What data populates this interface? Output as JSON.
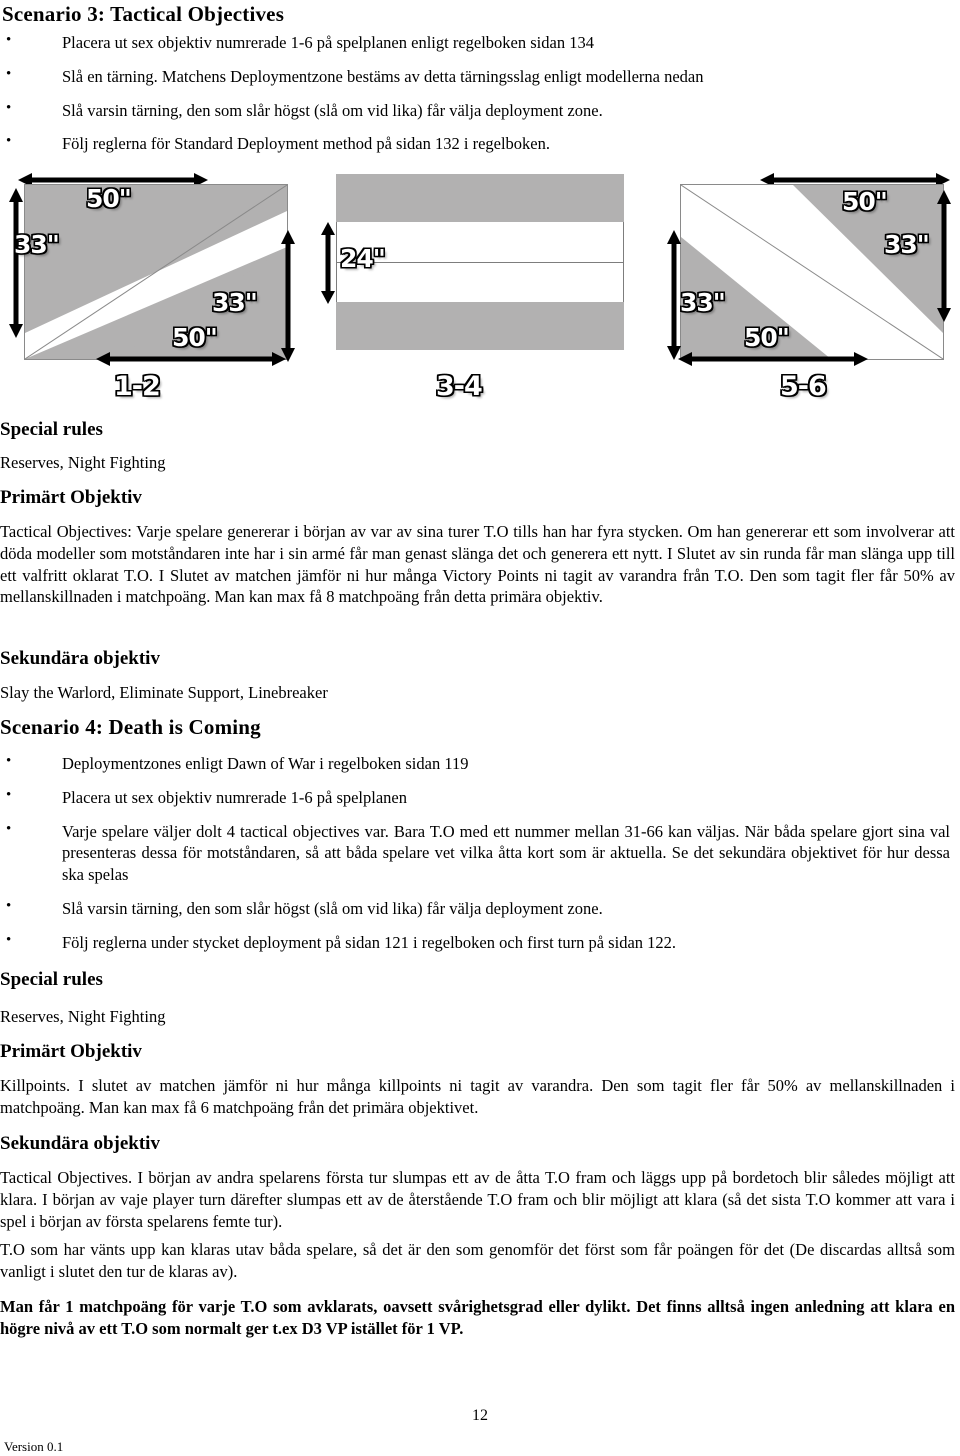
{
  "document": {
    "page_number": "12",
    "footer_version": "Version 0.1"
  },
  "scenario3": {
    "heading": "Scenario 3:  Tactical Objectives",
    "bullets": [
      "Placera ut sex objektiv numrerade 1-6 på spelplanen enligt regelboken sidan 134",
      "Slå en tärning. Matchens Deploymentzone bestäms av detta tärningsslag enligt modellerna nedan",
      "Slå varsin tärning, den som slår  högst (slå om vid lika) får välja deployment zone.",
      "Följ reglerna för Standard Deployment method på sidan 132 i regelboken."
    ],
    "special_rules_heading": "Special rules",
    "special_rules_text": "Reserves, Night Fighting",
    "primary_heading": "Primärt Objektiv",
    "primary_text": "Tactical Objectives: Varje spelare genererar i början av var av sina turer T.O tills han har fyra stycken. Om han genererar ett som involverar att döda modeller som motståndaren inte har i sin armé får man genast slänga det och generera ett nytt. I Slutet av sin runda får man slänga upp till ett valfritt oklarat T.O. I Slutet av matchen jämför ni hur många Victory Points ni tagit av varandra från T.O. Den som tagit fler får 50% av mellanskillnaden i matchpoäng. Man kan max få 8 matchpoäng från detta primära objektiv.",
    "secondary_heading": "Sekundära objektiv",
    "secondary_text": "Slay the Warlord, Eliminate Support, Linebreaker"
  },
  "deployment_diagrams": [
    {
      "name": "1-2",
      "type": "diagonal",
      "dims": [
        "50\"",
        "33\"",
        "33\"",
        "50\""
      ]
    },
    {
      "name": "3-4",
      "type": "horizontal-bands",
      "dims": [
        "24\""
      ]
    },
    {
      "name": "5-6",
      "type": "diagonal-mirrored",
      "dims": [
        "50\"",
        "33\"",
        "33\"",
        "50\""
      ]
    }
  ],
  "scenario4": {
    "heading": "Scenario 4: Death is Coming",
    "bullets": [
      "Deploymentzones enligt Dawn of War i regelboken sidan 119",
      "Placera ut sex objektiv numrerade 1-6 på spelplanen",
      "Varje spelare väljer dolt 4 tactical objectives var. Bara T.O med ett nummer mellan 31-66 kan väljas. När båda spelare gjort sina val presenteras dessa för motståndaren, så att båda spelare vet vilka åtta kort som är aktuella. Se det sekundära objektivet för hur dessa ska spelas",
      "Slå varsin tärning, den som slår  högst (slå om vid lika) får välja deployment zone.",
      "Följ reglerna under stycket deployment på sidan 121 i regelboken och first turn på sidan 122."
    ],
    "special_rules_heading": "Special rules",
    "special_rules_text": "Reserves, Night Fighting",
    "primary_heading": "Primärt Objektiv",
    "primary_text": "Killpoints. I slutet av matchen jämför ni hur många killpoints ni tagit av varandra. Den som tagit fler får 50% av mellanskillnaden i matchpoäng. Man kan max få 6 matchpoäng från det primära objektivet.",
    "secondary_heading": "Sekundära objektiv",
    "secondary_para1": "Tactical Objectives. I början av andra spelarens första tur slumpas ett av de åtta T.O fram och läggs upp på bordetoch blir således möjligt att klara. I början av vaje player turn därefter slumpas ett av de återstående T.O fram och blir möjligt att klara (så det sista T.O kommer att vara i spel i början av första spelarens femte tur).",
    "secondary_para2": "T.O som har vänts upp kan klaras utav båda spelare, så det är den som genomför det först som får poängen för det (De discardas alltså som vanligt i slutet den tur de klaras av).",
    "secondary_para3": "Man får 1 matchpoäng för varje T.O som avklarats, oavsett svårighetsgrad eller dylikt. Det finns alltså ingen anledning att klara en högre nivå av ett T.O som normalt ger t.ex D3 VP istället för 1 VP."
  }
}
